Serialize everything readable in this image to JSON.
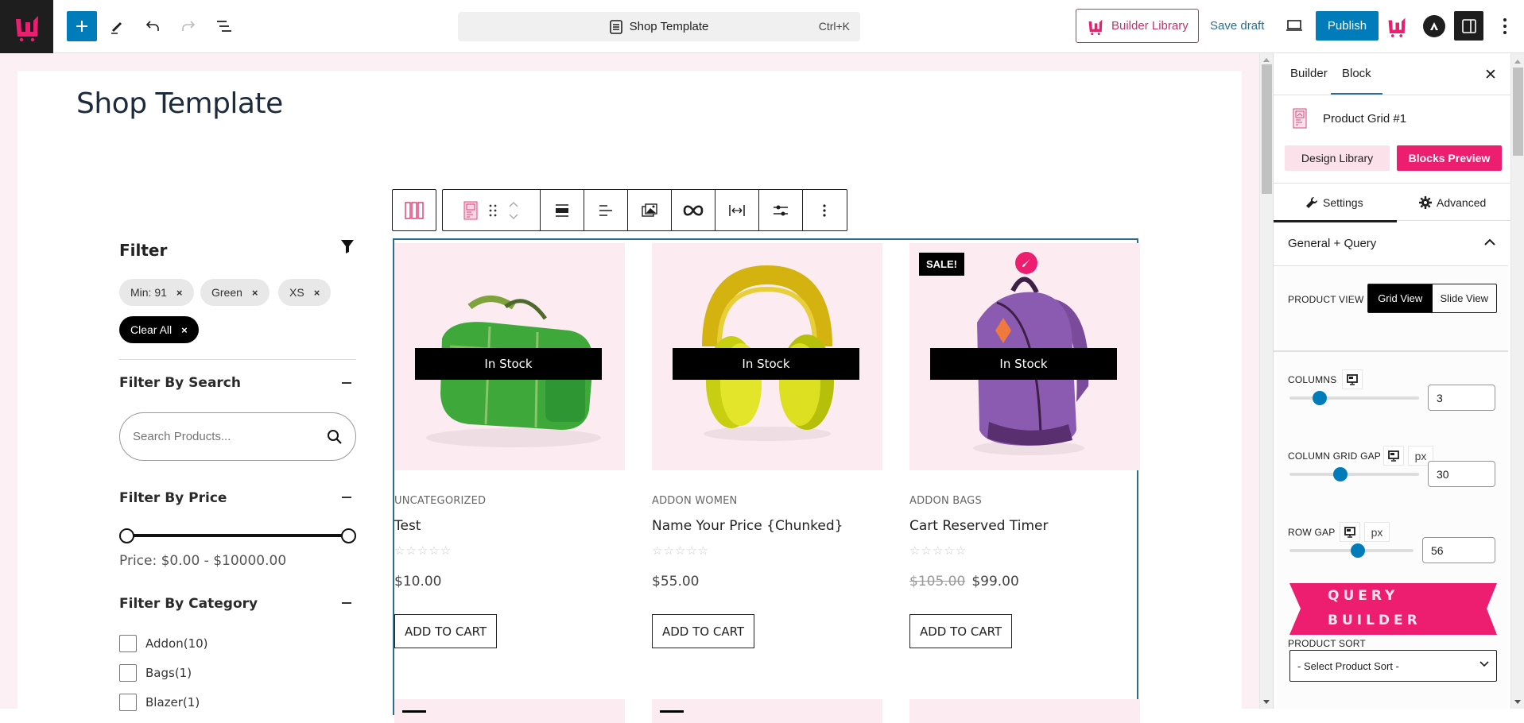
{
  "topbar": {
    "logo_icon": "wowstore-logo-icon",
    "add_block_icon": "plus-icon",
    "tools_icon": "pencil-icon",
    "undo_icon": "undo-icon",
    "redo_icon": "redo-icon",
    "list_view_icon": "list-view-icon",
    "document_title": "Shop Template",
    "shortcut": "Ctrl+K",
    "builder_library_label": "Builder Library",
    "save_draft_label": "Save draft",
    "publish_label": "Publish"
  },
  "page": {
    "title": "Shop Template"
  },
  "filter": {
    "heading": "Filter",
    "active_chips": [
      {
        "label": "Min: 91"
      },
      {
        "label": "Green"
      },
      {
        "label": "XS"
      }
    ],
    "clear_all_label": "Clear All",
    "chip_remove_glyph": "×",
    "search_section": {
      "title": "Filter By Search",
      "placeholder": "Search Products..."
    },
    "price_section": {
      "title": "Filter By Price",
      "min_value": 0,
      "max_value": 10000,
      "range_fraction_min": 0,
      "range_fraction_max": 1,
      "price_text": "Price: $0.00 - $10000.00"
    },
    "category_section": {
      "title": "Filter By Category",
      "items": [
        {
          "label": "Addon(10)",
          "checked": false
        },
        {
          "label": "Bags(1)",
          "checked": false
        },
        {
          "label": "Blazer(1)",
          "checked": false
        }
      ]
    }
  },
  "block_toolbar": {
    "items": [
      "columns-icon",
      "product-grid-icon",
      "drag-handle-icon",
      "move-up-down-icon",
      "align-full-icon",
      "align-left-text-icon",
      "gallery-icon",
      "link-icon",
      "width-icon",
      "settings-sliders-icon",
      "more-options-icon"
    ]
  },
  "products": [
    {
      "category": "UNCATEGORIZED",
      "name": "Test",
      "price": "$10.00",
      "old_price": "",
      "stock": "In Stock",
      "sale": "",
      "rating": 0,
      "button": "ADD TO CART",
      "image": "green-duffel-bag"
    },
    {
      "category": "ADDON  WOMEN",
      "name": "Name Your Price {Chunked}",
      "price": "$55.00",
      "old_price": "",
      "stock": "In Stock",
      "sale": "",
      "rating": 0,
      "button": "ADD TO CART",
      "image": "yellow-headphones"
    },
    {
      "category": "ADDON  BAGS",
      "name": "Cart Reserved Timer",
      "price": "$99.00",
      "old_price": "$105.00",
      "stock": "In Stock",
      "sale": "SALE!",
      "rating": 0,
      "button": "ADD TO CART",
      "image": "purple-backpack"
    }
  ],
  "stars_glyph": "☆☆☆☆☆",
  "panel": {
    "tabs": [
      {
        "label": "Builder"
      },
      {
        "label": "Block",
        "active": true
      }
    ],
    "close_glyph": "✕",
    "block_name": "Product Grid #1",
    "design_library_label": "Design Library",
    "blocks_preview_label": "Blocks Preview",
    "settings_tabs": [
      {
        "label": "Settings",
        "active": true
      },
      {
        "label": "Advanced"
      }
    ],
    "section_title": "General + Query",
    "product_view": {
      "label": "PRODUCT VIEW",
      "options": [
        "Grid View",
        "Slide View"
      ],
      "selected": "Grid View"
    },
    "columns": {
      "label": "COLUMNS",
      "value": "3",
      "fraction": 0.2
    },
    "column_gap": {
      "label": "COLUMN GRID GAP",
      "unit": "px",
      "value": "30",
      "fraction": 0.38
    },
    "row_gap": {
      "label": "ROW GAP",
      "unit": "px",
      "value": "56",
      "fraction": 0.56
    },
    "query_builder": {
      "line1": "QUERY",
      "line2": "BUILDER"
    },
    "product_sort": {
      "label": "PRODUCT SORT",
      "selected": "- Select Product Sort -"
    }
  },
  "colors": {
    "brand_pink": "#ed1e6f",
    "wp_blue": "#007cba",
    "selection_border": "#2b6d8c",
    "canvas_bg": "#fdf0f4"
  }
}
